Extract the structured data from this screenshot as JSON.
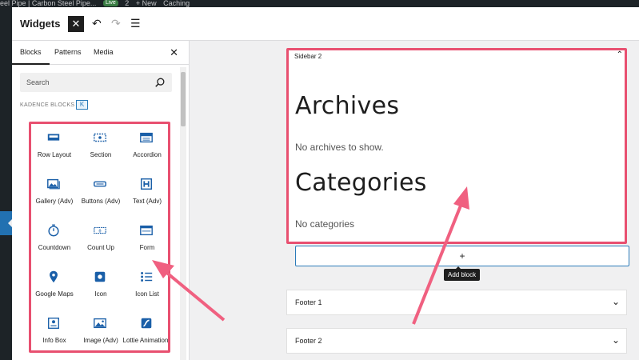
{
  "adminbar": {
    "site": "eel Pipe | Carbon Steel Pipe...",
    "live": "Live",
    "comments": "2",
    "new": "+ New",
    "caching": "Caching"
  },
  "header": {
    "title": "Widgets",
    "close": "✕",
    "undo": "↶",
    "redo": "↷",
    "list": "☰"
  },
  "sidebar": {
    "tabs": [
      {
        "label": "Blocks"
      },
      {
        "label": "Patterns"
      },
      {
        "label": "Media"
      }
    ],
    "close": "✕",
    "search_placeholder": "Search",
    "category": "KADENCE BLOCKS",
    "category_logo": "K",
    "blocks": [
      {
        "label": "Row Layout",
        "icon": "row-layout-icon"
      },
      {
        "label": "Section",
        "icon": "section-icon"
      },
      {
        "label": "Accordion",
        "icon": "accordion-icon"
      },
      {
        "label": "Gallery (Adv)",
        "icon": "gallery-icon"
      },
      {
        "label": "Buttons (Adv)",
        "icon": "buttons-icon"
      },
      {
        "label": "Text (Adv)",
        "icon": "text-heading-icon"
      },
      {
        "label": "Countdown",
        "icon": "countdown-icon"
      },
      {
        "label": "Count Up",
        "icon": "count-up-icon"
      },
      {
        "label": "Form",
        "icon": "form-icon"
      },
      {
        "label": "Google Maps",
        "icon": "map-pin-icon"
      },
      {
        "label": "Icon",
        "icon": "icon-block-icon"
      },
      {
        "label": "Icon List",
        "icon": "icon-list-icon"
      },
      {
        "label": "Info Box",
        "icon": "info-box-icon"
      },
      {
        "label": "Image (Adv)",
        "icon": "image-icon"
      },
      {
        "label": "Lottie Animations",
        "icon": "lottie-icon"
      }
    ]
  },
  "main": {
    "sidebar2": {
      "title": "Sidebar 2",
      "archives_heading": "Archives",
      "archives_text": "No archives to show.",
      "categories_heading": "Categories",
      "categories_text": "No categories"
    },
    "add_button": "+",
    "tooltip": "Add block",
    "footers": [
      {
        "title": "Footer 1"
      },
      {
        "title": "Footer 2"
      }
    ]
  },
  "colors": {
    "highlight": "#e85070",
    "accent": "#2b7bb9",
    "icon": "#1a5fa8"
  }
}
